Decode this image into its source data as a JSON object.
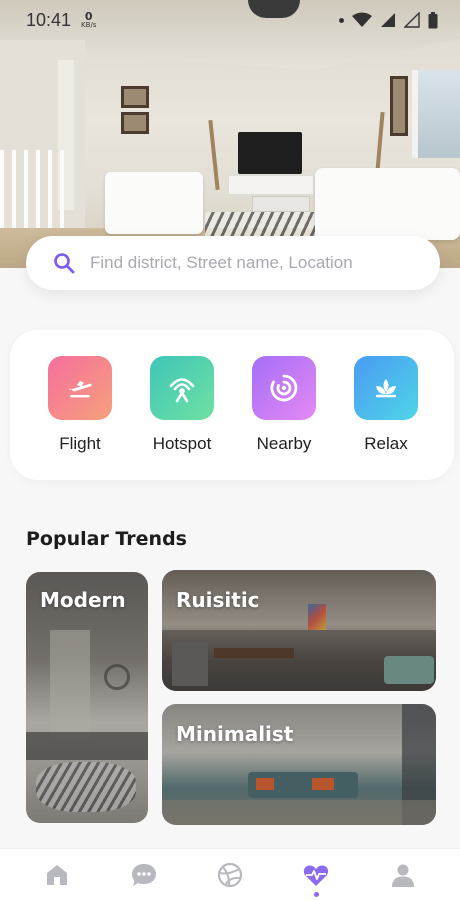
{
  "status_bar": {
    "time": "10:41",
    "speed_value": "0",
    "speed_unit": "KB/s"
  },
  "search": {
    "placeholder": "Find district, Street name, Location"
  },
  "categories": [
    {
      "label": "Flight",
      "icon": "flight-icon",
      "gradient": [
        "#f56f9e",
        "#f6a07c"
      ]
    },
    {
      "label": "Hotspot",
      "icon": "hotspot-icon",
      "gradient": [
        "#3fc6b8",
        "#6fe0a2"
      ]
    },
    {
      "label": "Nearby",
      "icon": "nearby-icon",
      "gradient": [
        "#a56ef8",
        "#e489f3"
      ]
    },
    {
      "label": "Relax",
      "icon": "relax-icon",
      "gradient": [
        "#4a9bf2",
        "#4ed5e8"
      ]
    }
  ],
  "trends": {
    "title": "Popular Trends",
    "items": [
      {
        "label": "Modern"
      },
      {
        "label": "Ruisitic"
      },
      {
        "label": "Minimalist"
      }
    ]
  },
  "bottom_nav": {
    "items": [
      {
        "icon": "home-icon",
        "active": false
      },
      {
        "icon": "chat-icon",
        "active": false
      },
      {
        "icon": "dribbble-icon",
        "active": false
      },
      {
        "icon": "heart-pulse-icon",
        "active": true
      },
      {
        "icon": "profile-icon",
        "active": false
      }
    ],
    "active_color": "#8b6bf0",
    "inactive_color": "#b8b8bf"
  },
  "accent_color": "#7b5cf0"
}
